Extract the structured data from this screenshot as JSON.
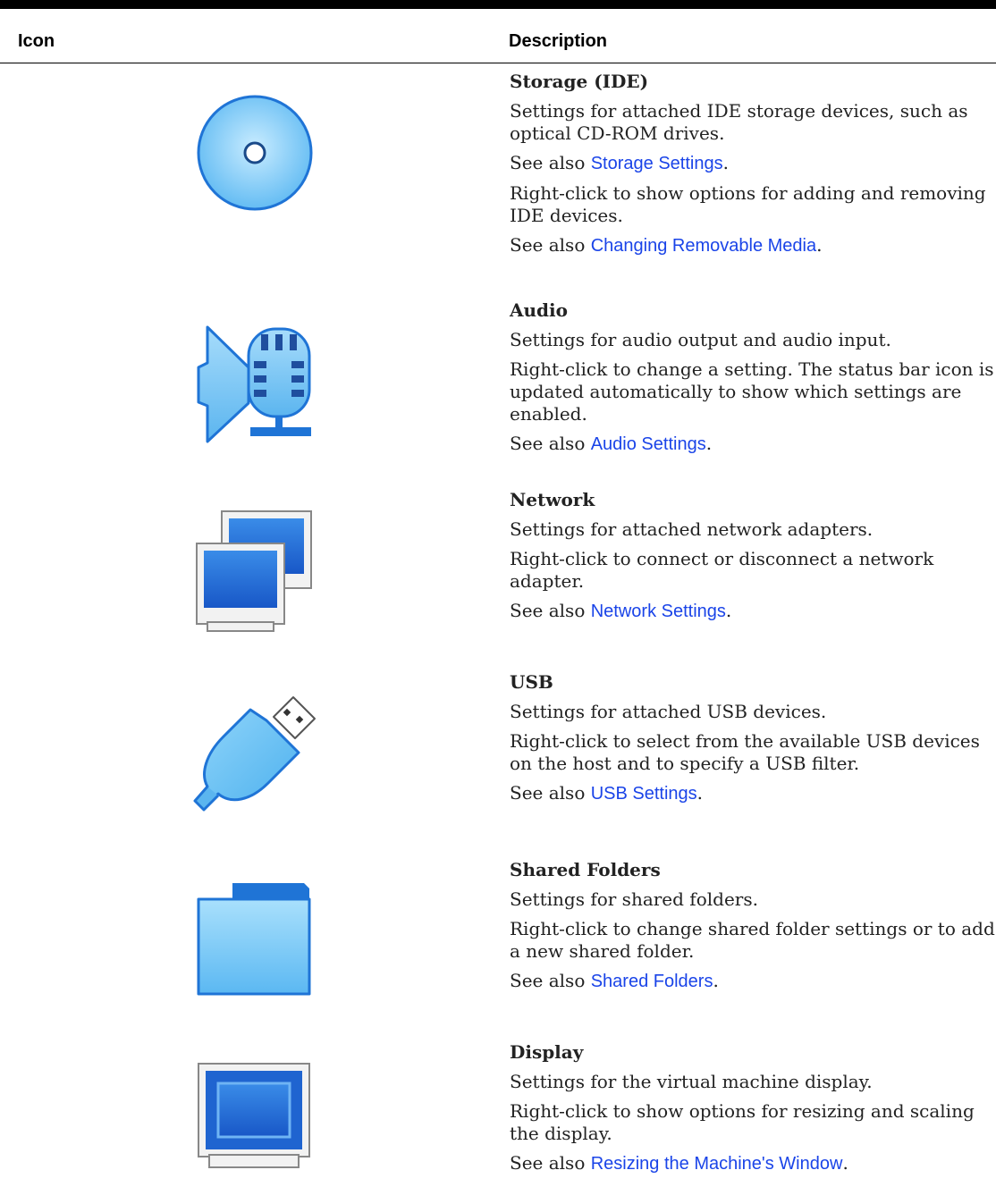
{
  "table": {
    "col_icon": "Icon",
    "col_description": "Description"
  },
  "rows": [
    {
      "icon": "optical-disc-icon",
      "title": "Storage (IDE)",
      "p1": "Settings for attached IDE storage devices, such as optical CD-ROM drives.",
      "p2_prefix": "See also ",
      "p2_link": "Storage Settings",
      "p3": "Right-click to show options for adding and removing IDE devices.",
      "p4_prefix": "See also ",
      "p4_link": "Changing Removable Media"
    },
    {
      "icon": "audio-icon",
      "title": "Audio",
      "p1": "Settings for audio output and audio input.",
      "p2": "Right-click to change a setting. The status bar icon is updated automatically to show which settings are enabled.",
      "p3_prefix": "See also ",
      "p3_link": "Audio Settings"
    },
    {
      "icon": "network-icon",
      "title": "Network",
      "p1": "Settings for attached network adapters.",
      "p2": "Right-click to connect or disconnect a network adapter.",
      "p3_prefix": "See also ",
      "p3_link": "Network Settings"
    },
    {
      "icon": "usb-icon",
      "title": "USB",
      "p1": "Settings for attached USB devices.",
      "p2": "Right-click to select from the available USB devices on the host and to specify a USB filter.",
      "p3_prefix": "See also ",
      "p3_link": "USB Settings"
    },
    {
      "icon": "folder-icon",
      "title": "Shared Folders",
      "p1": "Settings for shared folders.",
      "p2": "Right-click to change shared folder settings or to add a new shared folder.",
      "p3_prefix": "See also ",
      "p3_link": "Shared Folders"
    },
    {
      "icon": "display-icon",
      "title": "Display",
      "p1": "Settings for the virtual machine display.",
      "p2": "Right-click to show options for resizing and scaling the display.",
      "p3_prefix": "See also ",
      "p3_link": "Resizing the Machine's Window"
    }
  ],
  "colors": {
    "link": "#1a44e8",
    "icon_blue": "#1f74d6",
    "icon_light": "#6cc3f5"
  }
}
